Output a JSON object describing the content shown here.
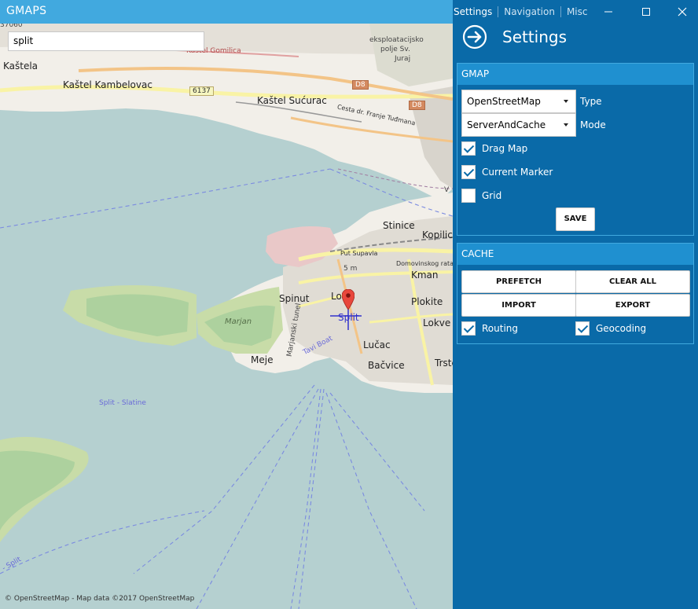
{
  "window": {
    "title": "GMAPS",
    "tabs": [
      {
        "label": "Settings",
        "active": true
      },
      {
        "label": "Navigation",
        "active": false
      },
      {
        "label": "Misc",
        "active": false
      }
    ]
  },
  "map": {
    "search_value": "split",
    "attribution": "© OpenStreetMap - Map data ©2017 OpenStreetMap",
    "labels": {
      "kastela": "Kaštela",
      "kastel_kambelovac": "Kaštel Kambelovac",
      "kastel_sucurac": "Kaštel Sućurac",
      "eksploatacijsko": "eksploatacijsko",
      "polje": "polje Sv.",
      "juraj": "Juraj",
      "gomilica": "Kaštel Gomilica",
      "cesta": "Cesta dr. Franje Tuđmana",
      "put_supavla": "Put Supavla",
      "domovinskog": "Domovinskog rata",
      "stinice": "Stinice",
      "kopilica": "Kopilica",
      "kman": "Kman",
      "spinut": "Spinut",
      "lora": "Lora",
      "plokite": "Plokite",
      "lokve": "Lokve",
      "split": "Split",
      "marjan": "Marjan",
      "lucac": "Lučac",
      "meje": "Meje",
      "bacvice": "Bačvice",
      "trstenik": "Trste",
      "split_slatine": "Split - Slatine",
      "tavi_boat": "Tavi Boat",
      "marjanski_tunel": "Marjanski tunel",
      "split_left": "- Split",
      "cut_code": "37060",
      "w_v": "V",
      "s_m": "5 m",
      "road_6137": "6137",
      "road_d8a": "D8",
      "road_d8b": "D8"
    }
  },
  "settings": {
    "title": "Settings",
    "gmap": {
      "header": "GMAP",
      "type_value": "OpenStreetMap",
      "type_label": "Type",
      "mode_value": "ServerAndCache",
      "mode_label": "Mode",
      "drag_map": {
        "label": "Drag Map",
        "checked": true
      },
      "current_marker": {
        "label": "Current Marker",
        "checked": true
      },
      "grid": {
        "label": "Grid",
        "checked": false
      },
      "save_label": "SAVE"
    },
    "cache": {
      "header": "CACHE",
      "prefetch": "PREFETCH",
      "clear_all": "CLEAR ALL",
      "import": "IMPORT",
      "export": "EXPORT",
      "routing": {
        "label": "Routing",
        "checked": true
      },
      "geocoding": {
        "label": "Geocoding",
        "checked": true
      }
    }
  },
  "colors": {
    "title_bar": "#41a9df",
    "panel": "#0a6aa8",
    "group_header": "#1f90d0",
    "water": "#b5d0d0",
    "land": "#f2efe9",
    "park": "#c8dca8"
  },
  "icons": [
    "back-arrow-icon",
    "minimize-icon",
    "maximize-icon",
    "close-icon",
    "map-pin-icon",
    "chevron-down-icon",
    "checkmark-icon"
  ]
}
